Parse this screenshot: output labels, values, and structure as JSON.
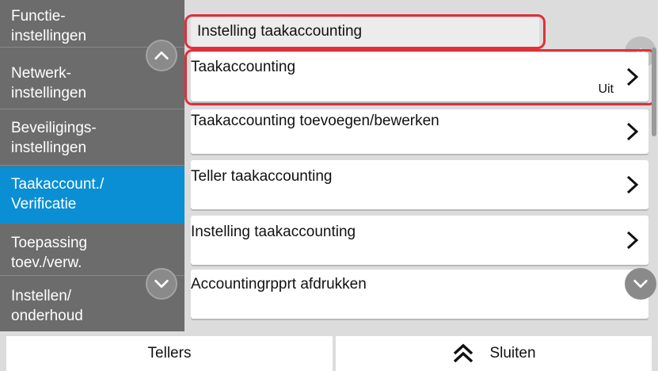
{
  "sidebar": {
    "items": [
      {
        "line1": "Functie-",
        "line2": "instellingen"
      },
      {
        "line1": "Netwerk-",
        "line2": "instellingen"
      },
      {
        "line1": "Beveiligings-",
        "line2": "instellingen"
      },
      {
        "line1": "Taakaccount./",
        "line2": "Verificatie"
      },
      {
        "line1": "Toepassing",
        "line2": "toev./verw."
      },
      {
        "line1": "Instellen/",
        "line2": "onderhoud"
      }
    ],
    "active_index": 3,
    "scroll_up_icon": "chevron-up-icon",
    "scroll_down_icon": "chevron-down-icon"
  },
  "main": {
    "breadcrumb": "Instelling taakaccounting",
    "rows": [
      {
        "title": "Taakaccounting",
        "value": "Uit"
      },
      {
        "title": "Taakaccounting toevoegen/bewerken",
        "value": ""
      },
      {
        "title": "Teller taakaccounting",
        "value": ""
      },
      {
        "title": "Instelling taakaccounting",
        "value": ""
      },
      {
        "title": "Accountingrpprt afdrukken",
        "value": ""
      }
    ],
    "row_icon": "chevron-right-icon"
  },
  "bottom": {
    "left_label": "Tellers",
    "right_label": "Sluiten",
    "right_icon": "double-chevron-up-icon"
  },
  "colors": {
    "sidebar_bg": "#6c6c6c",
    "active_bg": "#0a8fd4",
    "main_bg": "#dcdcdc",
    "highlight": "#e0303a"
  }
}
